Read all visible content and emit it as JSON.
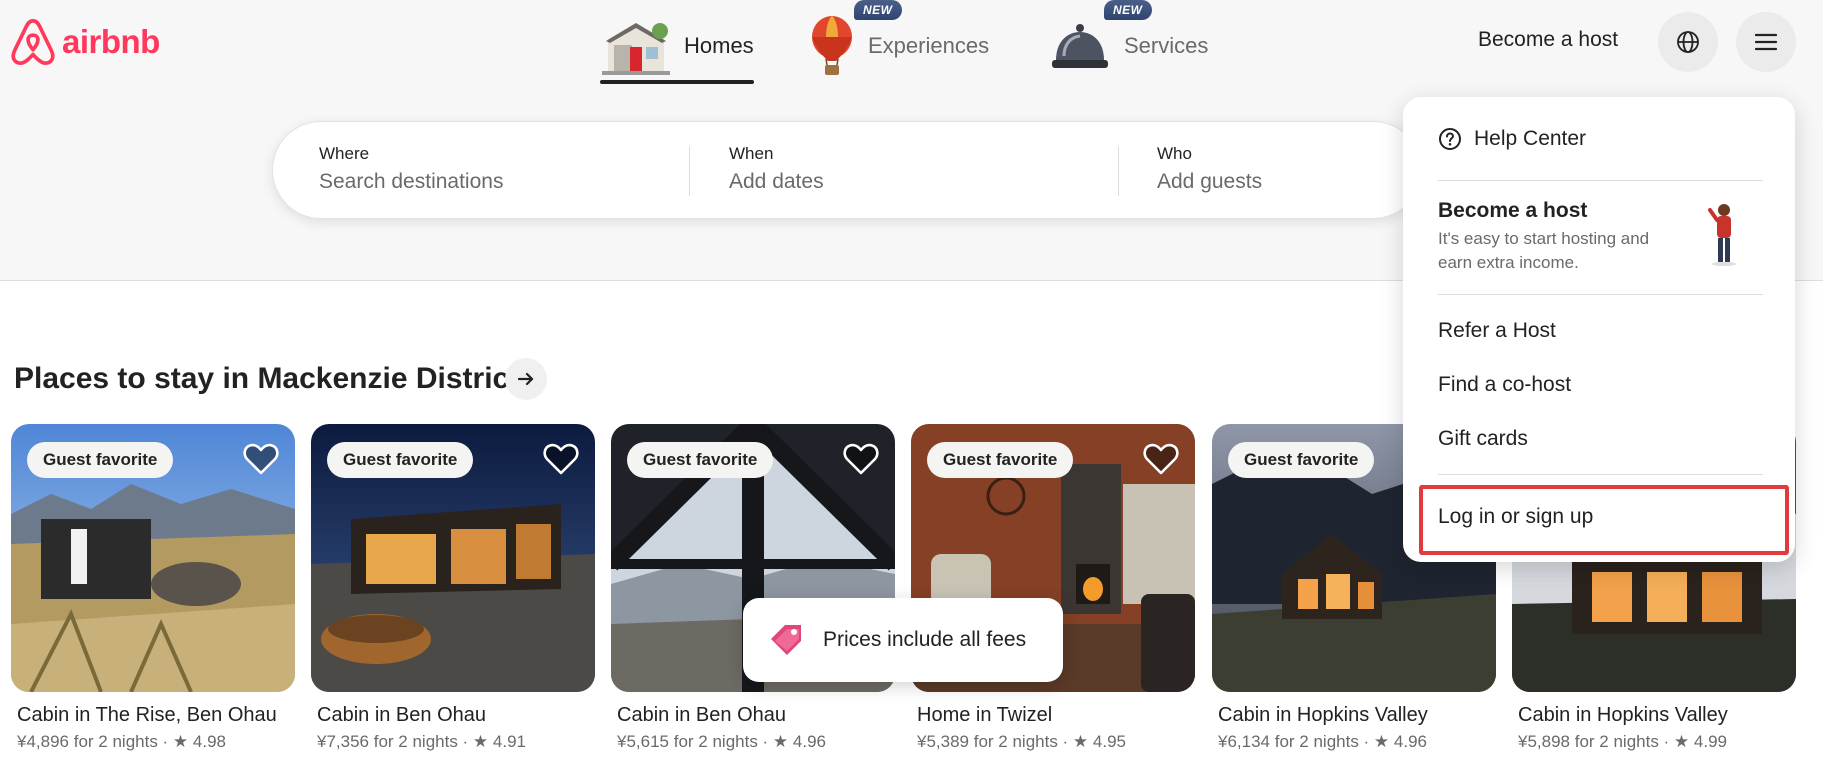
{
  "brand": {
    "name": "airbnb",
    "color": "#ff385c"
  },
  "nav": {
    "tabs": [
      {
        "label": "Homes",
        "icon": "house-icon",
        "active": true
      },
      {
        "label": "Experiences",
        "icon": "hot-air-balloon-icon",
        "badge": "NEW"
      },
      {
        "label": "Services",
        "icon": "service-bell-icon",
        "badge": "NEW"
      }
    ],
    "host_label": "Become a host"
  },
  "search": {
    "where": {
      "title": "Where",
      "placeholder": "Search destinations"
    },
    "when": {
      "title": "When",
      "placeholder": "Add dates"
    },
    "who": {
      "title": "Who",
      "placeholder": "Add guests"
    }
  },
  "section": {
    "title": "Places to stay in Mackenzie District"
  },
  "listings": [
    {
      "badge": "Guest favorite",
      "title": "Cabin in The Rise, Ben Ohau",
      "price": "¥4,896 for 2 nights",
      "rating": "4.98"
    },
    {
      "badge": "Guest favorite",
      "title": "Cabin in Ben Ohau",
      "price": "¥7,356 for 2 nights",
      "rating": "4.91"
    },
    {
      "badge": "Guest favorite",
      "title": "Cabin in Ben Ohau",
      "price": "¥5,615 for 2 nights",
      "rating": "4.96"
    },
    {
      "badge": "Guest favorite",
      "title": "Home in Twizel",
      "price": "¥5,389 for 2 nights",
      "rating": "4.95"
    },
    {
      "badge": "Guest favorite",
      "title": "Cabin in Hopkins Valley",
      "price": "¥6,134 for 2 nights",
      "rating": "4.96"
    },
    {
      "badge": "",
      "title": "Cabin in Hopkins Valley",
      "price": "¥5,898 for 2 nights",
      "rating": "4.99"
    }
  ],
  "fees_notice": "Prices include all fees",
  "menu": {
    "help": "Help Center",
    "host_title": "Become a host",
    "host_desc": "It's easy to start hosting and earn extra income.",
    "refer": "Refer a Host",
    "cohost": "Find a co-host",
    "gift": "Gift cards",
    "login": "Log in or sign up"
  }
}
